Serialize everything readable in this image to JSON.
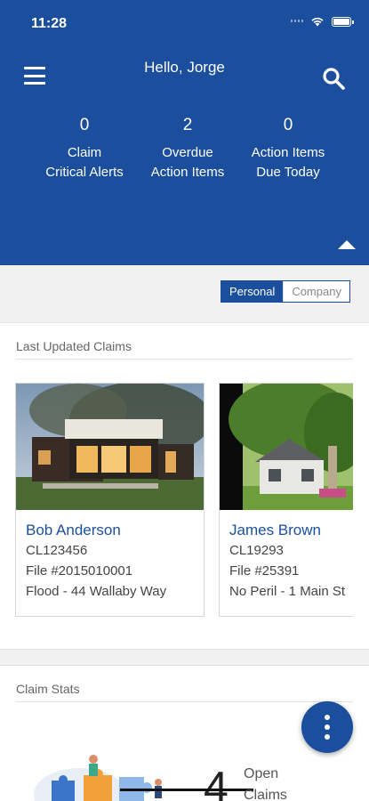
{
  "status_bar": {
    "time": "11:28"
  },
  "header": {
    "greeting": "Hello, Jorge",
    "stats": [
      {
        "value": "0",
        "label_line1": "Claim",
        "label_line2": "Critical Alerts"
      },
      {
        "value": "2",
        "label_line1": "Overdue",
        "label_line2": "Action Items"
      },
      {
        "value": "0",
        "label_line1": "Action Items",
        "label_line2": "Due Today"
      }
    ]
  },
  "toggle": {
    "personal": "Personal",
    "company": "Company",
    "selected": "Personal"
  },
  "last_updated": {
    "title": "Last Updated Claims",
    "claims": [
      {
        "name": "Bob Anderson",
        "claim_id": "CL123456",
        "file": "File #2015010001",
        "detail": "Flood - 44 Wallaby Way"
      },
      {
        "name": "James Brown",
        "claim_id": "CL19293",
        "file": "File #25391",
        "detail": "No Peril - 1 Main St"
      }
    ]
  },
  "claim_stats": {
    "title": "Claim Stats",
    "open_count": "4",
    "open_label_line1": "Open",
    "open_label_line2": "Claims"
  },
  "colors": {
    "brand_blue": "#1b4f9e",
    "background": "#f1f1f1"
  },
  "icons": {
    "menu": "hamburger-icon",
    "search": "search-icon",
    "collapse": "chevron-up-icon",
    "fab": "more-vertical-icon"
  }
}
